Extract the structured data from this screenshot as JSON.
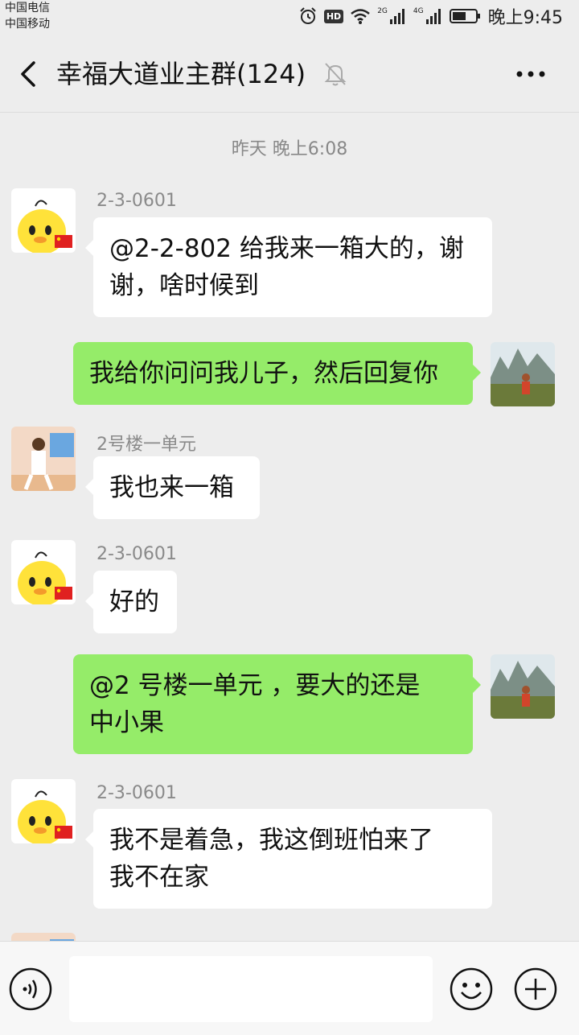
{
  "status_bar": {
    "carrier_1": "中国电信",
    "carrier_2": "中国移动",
    "hd": "HD",
    "net_1": "2G",
    "net_2": "4G",
    "time": "晚上9:45",
    "icons": [
      "alarm-icon",
      "wifi-icon",
      "signal-icon",
      "battery-icon"
    ]
  },
  "header": {
    "title": "幸福大道业主群(124)",
    "icons": [
      "back-icon",
      "mute-bell-icon",
      "more-icon"
    ]
  },
  "chat": {
    "timestamp": "昨天 晚上6:08",
    "messages": [
      {
        "direction": "in",
        "sender": "2-3-0601",
        "avatar": "duck-avatar",
        "lines": [
          "@2-2-802  给我来一箱大的，谢",
          "谢，啥时候到"
        ]
      },
      {
        "direction": "out",
        "avatar": "scenery-avatar",
        "lines": [
          "我给你问问我儿子，然后回复你"
        ]
      },
      {
        "direction": "in",
        "sender": "2号楼一单元",
        "avatar": "child-photo-avatar",
        "lines": [
          "我也来一箱"
        ]
      },
      {
        "direction": "in",
        "sender": "2-3-0601",
        "avatar": "duck-avatar",
        "lines": [
          "好的"
        ]
      },
      {
        "direction": "out",
        "avatar": "scenery-avatar",
        "lines": [
          "@2 号楼一单元  ，要大的还是",
          "中小果"
        ]
      },
      {
        "direction": "in",
        "sender": "2-3-0601",
        "avatar": "duck-avatar",
        "lines": [
          "我不是着急，我这倒班怕来了",
          "我不在家"
        ]
      }
    ]
  },
  "bottom_bar": {
    "input_value": "",
    "icons": [
      "voice-icon",
      "emoji-icon",
      "plus-icon"
    ]
  },
  "colors": {
    "background": "#ededed",
    "incoming_bubble": "#ffffff",
    "outgoing_bubble": "#95ec69",
    "sender_text": "#8a8a8a"
  }
}
